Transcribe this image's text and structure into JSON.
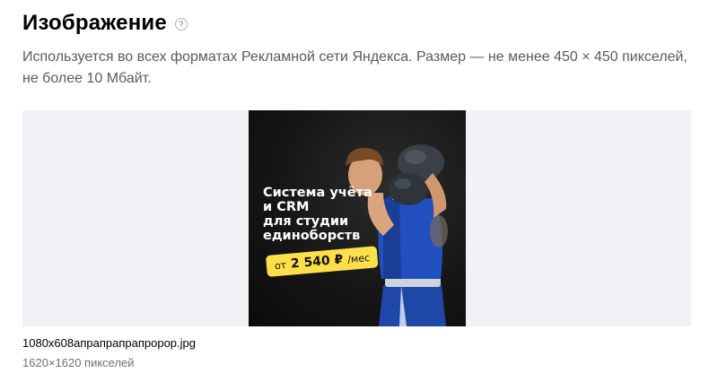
{
  "section": {
    "title": "Изображение",
    "help_icon": "question-circle-icon",
    "description": "Используется во всех форматах Рекламной сети Яндекса. Размер — не менее 450 × 450 пикселей, не более 10 Мбайт."
  },
  "preview": {
    "banner": {
      "headline_lines": [
        "Система учёта",
        "и CRM",
        "для студии",
        "единоборств"
      ],
      "price_prefix": "от",
      "price_amount": "2 540 ₽",
      "price_suffix": "/мес"
    }
  },
  "file": {
    "name": "1080x608апрапрапрапророр.jpg",
    "dimensions": "1620×1620 пикселей"
  },
  "colors": {
    "preview_bg": "#f0f2f6",
    "price_badge": "#fddf4a",
    "description_text": "#555b63"
  }
}
